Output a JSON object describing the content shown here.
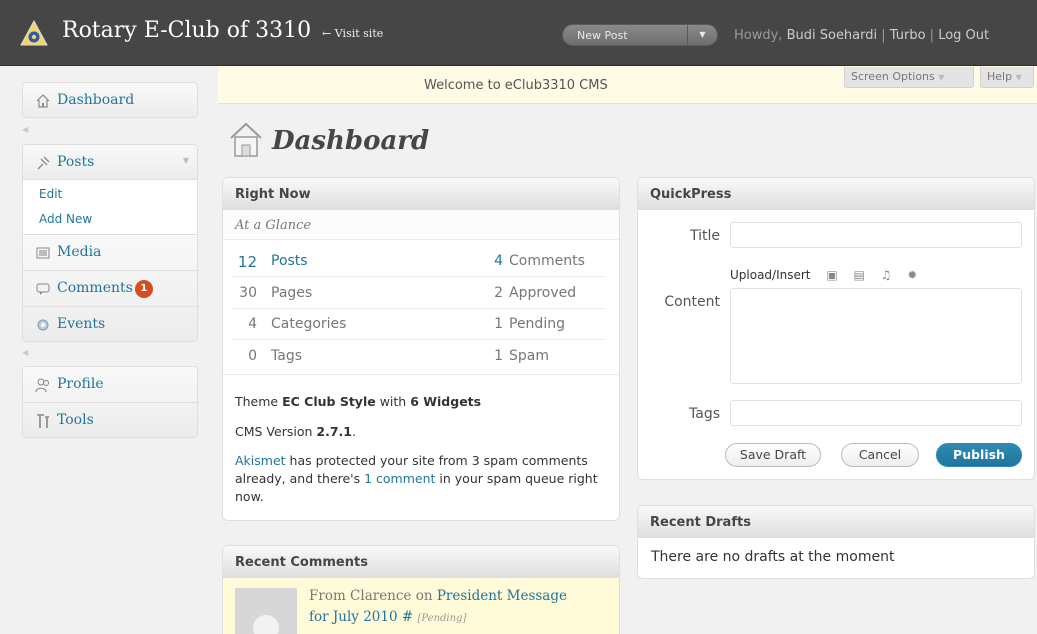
{
  "header": {
    "site_title": "Rotary E-Club of 3310",
    "visit_site": "← Visit site",
    "new_post": "New Post",
    "howdy_prefix": "Howdy, ",
    "user": "Budi Soehardi",
    "sep1": " | ",
    "turbo": "Turbo",
    "sep2": " | ",
    "logout": "Log Out"
  },
  "welcome": "Welcome to eClub3310 CMS",
  "screen_options": "Screen Options",
  "help": "Help",
  "sidebar": {
    "dashboard": "Dashboard",
    "posts": "Posts",
    "edit": "Edit",
    "add_new": "Add New",
    "media": "Media",
    "comments": "Comments",
    "comments_badge": "1",
    "events": "Events",
    "profile": "Profile",
    "tools": "Tools"
  },
  "page_title": "Dashboard",
  "right_now": {
    "title": "Right Now",
    "subtitle": "At a Glance",
    "rows": [
      {
        "left_num": "12",
        "left_label": "Posts",
        "right_num": "4",
        "right_label": "Comments"
      },
      {
        "left_num": "30",
        "left_label": "Pages",
        "right_num": "2",
        "right_label": "Approved"
      },
      {
        "left_num": "4",
        "left_label": "Categories",
        "right_num": "1",
        "right_label": "Pending"
      },
      {
        "left_num": "0",
        "left_label": "Tags",
        "right_num": "1",
        "right_label": "Spam"
      }
    ],
    "theme_prefix": "Theme ",
    "theme_name": "EC Club Style",
    "theme_mid": " with ",
    "widgets": "6 Widgets",
    "cms_prefix": "CMS Version ",
    "cms_version": "2.7.1",
    "cms_suffix": ".",
    "akismet_link": "Akismet",
    "akismet_text1": " has protected your site from 3 spam comments already, and there's ",
    "akismet_comment_link": "1 comment",
    "akismet_text2": " in your spam queue right now."
  },
  "quickpress": {
    "title": "QuickPress",
    "title_label": "Title",
    "upload_label": "Upload/Insert",
    "content_label": "Content",
    "tags_label": "Tags",
    "save_draft": "Save Draft",
    "cancel": "Cancel",
    "publish": "Publish"
  },
  "recent_drafts": {
    "title": "Recent Drafts",
    "empty": "There are no drafts at the moment"
  },
  "recent_comments": {
    "title": "Recent Comments",
    "from": "From Clarence on ",
    "post_link": "President Message for July 2010 #",
    "status": "[Pending]"
  },
  "colors": {
    "header_bg": "#464646",
    "link": "#21759b",
    "badge": "#d54e21",
    "welcome_bg": "#fffbe4",
    "publish_bg": "#21759b"
  }
}
